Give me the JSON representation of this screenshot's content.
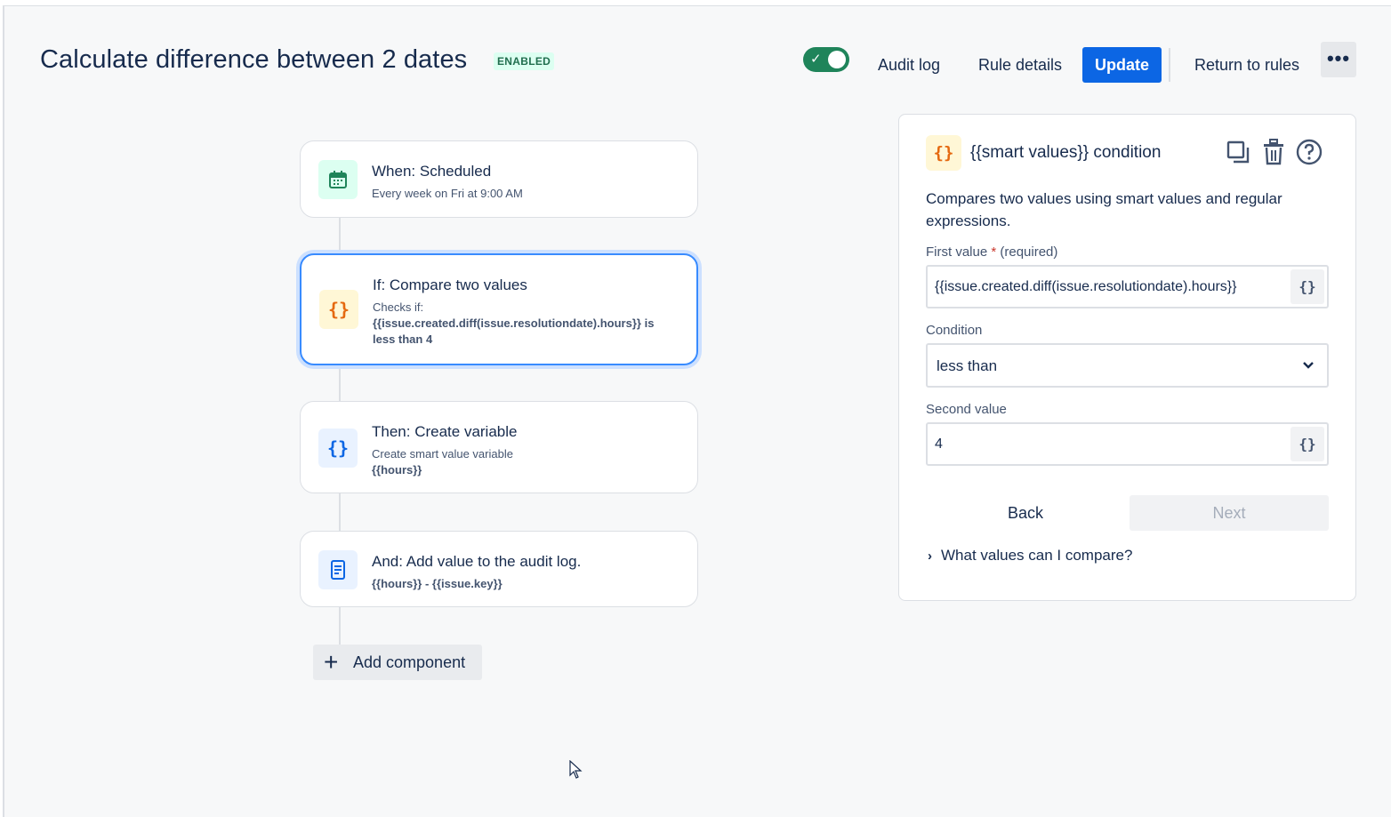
{
  "header": {
    "title": "Calculate difference between 2 dates",
    "status_badge": "ENABLED",
    "toggle_on": true,
    "audit_log": "Audit log",
    "rule_details": "Rule details",
    "update": "Update",
    "return_to_rules": "Return to rules",
    "more_icon": "ellipsis-icon"
  },
  "flow": {
    "components": [
      {
        "icon": "calendar-icon",
        "title": "When: Scheduled",
        "subtitle": "Every week on Fri at 9:00 AM"
      },
      {
        "icon": "curly-braces-icon",
        "title": "If: Compare two values",
        "subtitle": "Checks if:",
        "detail": "{{issue.created.diff(issue.resolutiondate).hours}} is less than 4",
        "selected": true
      },
      {
        "icon": "curly-braces-icon",
        "title": "Then: Create variable",
        "subtitle": "Create smart value variable",
        "detail": "{{hours}}"
      },
      {
        "icon": "document-icon",
        "title": "And: Add value to the audit log.",
        "detail": "{{hours}} - {{issue.key}}"
      }
    ],
    "add_component": "Add component"
  },
  "panel": {
    "title": "{{smart values}} condition",
    "description": "Compares two values using smart values and regular expressions.",
    "first_value_label": "First value",
    "required_mark": "*",
    "required_text": "(required)",
    "first_value": "{{issue.created.diff(issue.resolutiondate).hours}}",
    "condition_label": "Condition",
    "condition_value": "less than",
    "second_value_label": "Second value",
    "second_value": "4",
    "back": "Back",
    "next": "Next",
    "help_link": "What values can I compare?",
    "braces_glyph": "{}"
  },
  "colors": {
    "primary": "#0c66e4",
    "toggle": "#1f845a",
    "selected_border": "#388bff"
  }
}
